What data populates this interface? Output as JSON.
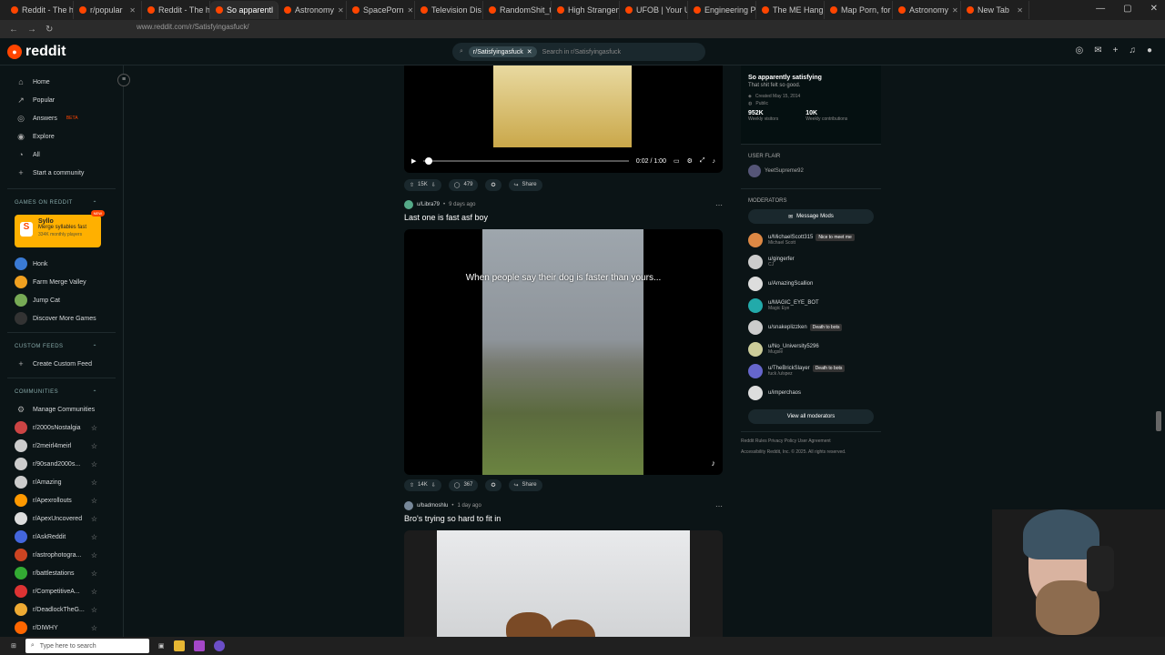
{
  "browser": {
    "tabs": [
      {
        "label": "Reddit - The hea"
      },
      {
        "label": "r/popular"
      },
      {
        "label": "Reddit - The hea"
      },
      {
        "label": "So apparentl",
        "active": true
      },
      {
        "label": "Astronomy"
      },
      {
        "label": "SpacePorn"
      },
      {
        "label": "Television Dis"
      },
      {
        "label": "RandomShit_tSaw"
      },
      {
        "label": "High Strangeness"
      },
      {
        "label": "UFOB | Your UAP"
      },
      {
        "label": "Engineering Porn"
      },
      {
        "label": "The ME Hang Out"
      },
      {
        "label": "Map Porn, for ent"
      },
      {
        "label": "Astronomy"
      },
      {
        "label": "New Tab"
      }
    ],
    "url": "www.reddit.com/r/Satisfyingasfuck/"
  },
  "header": {
    "logo_text": "reddit",
    "search_chip": "r/Satisfyingasfuck",
    "search_placeholder": "Search in r/Satisfyingasfuck"
  },
  "sidebar": {
    "nav": [
      {
        "label": "Home",
        "icon": "home-icon",
        "glyph": "⌂"
      },
      {
        "label": "Popular",
        "icon": "popular-icon",
        "glyph": "↗"
      },
      {
        "label": "Answers",
        "icon": "answers-icon",
        "glyph": "◎",
        "badge": "BETA"
      },
      {
        "label": "Explore",
        "icon": "explore-icon",
        "glyph": "◉"
      },
      {
        "label": "All",
        "icon": "all-icon",
        "glyph": "◔"
      },
      {
        "label": "Start a community",
        "icon": "plus-icon",
        "glyph": "+"
      }
    ],
    "games_label": "GAMES ON REDDIT",
    "game_card": {
      "title": "Syllo",
      "desc": "Merge syllables fast",
      "players": "334K monthly players",
      "badge": "NEW"
    },
    "games": [
      "Honk",
      "Farm Merge Valley",
      "Jump Cat",
      "Discover More Games"
    ],
    "custom_feeds_label": "CUSTOM FEEDS",
    "create_feed": "Create Custom Feed",
    "communities_label": "COMMUNITIES",
    "manage": "Manage Communities",
    "communities": [
      {
        "name": "r/2000sNostalgia",
        "color": "#c44"
      },
      {
        "name": "r/2meirl4meirl",
        "color": "#ccc"
      },
      {
        "name": "r/90sand2000s...",
        "color": "#ccc"
      },
      {
        "name": "r/Amazing",
        "color": "#ccc"
      },
      {
        "name": "r/Apexrollouts",
        "color": "#f90"
      },
      {
        "name": "r/ApexUncovered",
        "color": "#ddd"
      },
      {
        "name": "r/AskReddit",
        "color": "#46d"
      },
      {
        "name": "r/astrophotogra...",
        "color": "#c42"
      },
      {
        "name": "r/battlestations",
        "color": "#3a3"
      },
      {
        "name": "r/CompetitiveA...",
        "color": "#d33"
      },
      {
        "name": "r/DeadlockTheG...",
        "color": "#ea3"
      },
      {
        "name": "r/DIWHY",
        "color": "#f60"
      }
    ]
  },
  "feed": {
    "post1": {
      "upvotes": "15K",
      "comments": "479",
      "share": "Share",
      "time": "0:02 / 1:00"
    },
    "post2": {
      "user": "u/Libra79",
      "age": "9 days ago",
      "title": "Last one is fast asf boy",
      "caption": "When people say their dog is faster than yours...",
      "upvotes": "14K",
      "comments": "367",
      "share": "Share"
    },
    "post3": {
      "user": "u/badmoshlu",
      "age": "1 day ago",
      "title": "Bro's trying so hard to fit in"
    }
  },
  "rightbar": {
    "title": "So apparently satisfying",
    "subtitle": "That shit felt so good.",
    "created": "Created May 15, 2014",
    "public": "Public",
    "stats": [
      {
        "num": "952K",
        "label": "Weekly visitors"
      },
      {
        "num": "10K",
        "label": "Weekly contributions"
      }
    ],
    "user_flair_label": "USER FLAIR",
    "user_flair": "YeetSupreme92",
    "moderators_label": "MODERATORS",
    "message_mods": "Message Mods",
    "mods": [
      {
        "name": "u/MichaelScott315",
        "flair": "Michael Scott",
        "tag": "Nice to meet me",
        "color": "#d84"
      },
      {
        "name": "u/gingerfer",
        "flair": "CJ",
        "tag": "",
        "color": "#ccc"
      },
      {
        "name": "u/AmazingScallion",
        "flair": "",
        "tag": "",
        "color": "#ddd"
      },
      {
        "name": "u/MAGIC_EYE_BOT",
        "flair": "Magic Eye",
        "tag": "",
        "color": "#2aa"
      },
      {
        "name": "u/snakeplizzken",
        "flair": "",
        "tag": "Death to bots",
        "color": "#ccc"
      },
      {
        "name": "u/No_University5296",
        "flair": "Mugsie",
        "tag": "",
        "color": "#cc9"
      },
      {
        "name": "u/TheBrickSlayer",
        "flair": "fuck /u/spez",
        "tag": "Death to bots",
        "color": "#66c"
      },
      {
        "name": "u/imperchaos",
        "flair": "",
        "tag": "",
        "color": "#ddd"
      }
    ],
    "view_all": "View all moderators",
    "footer1": "Reddit Rules  Privacy Policy  User Agreement",
    "footer2": "Accessibility  Reddit, Inc. © 2025. All rights reserved."
  },
  "taskbar": {
    "search": "Type here to search"
  }
}
